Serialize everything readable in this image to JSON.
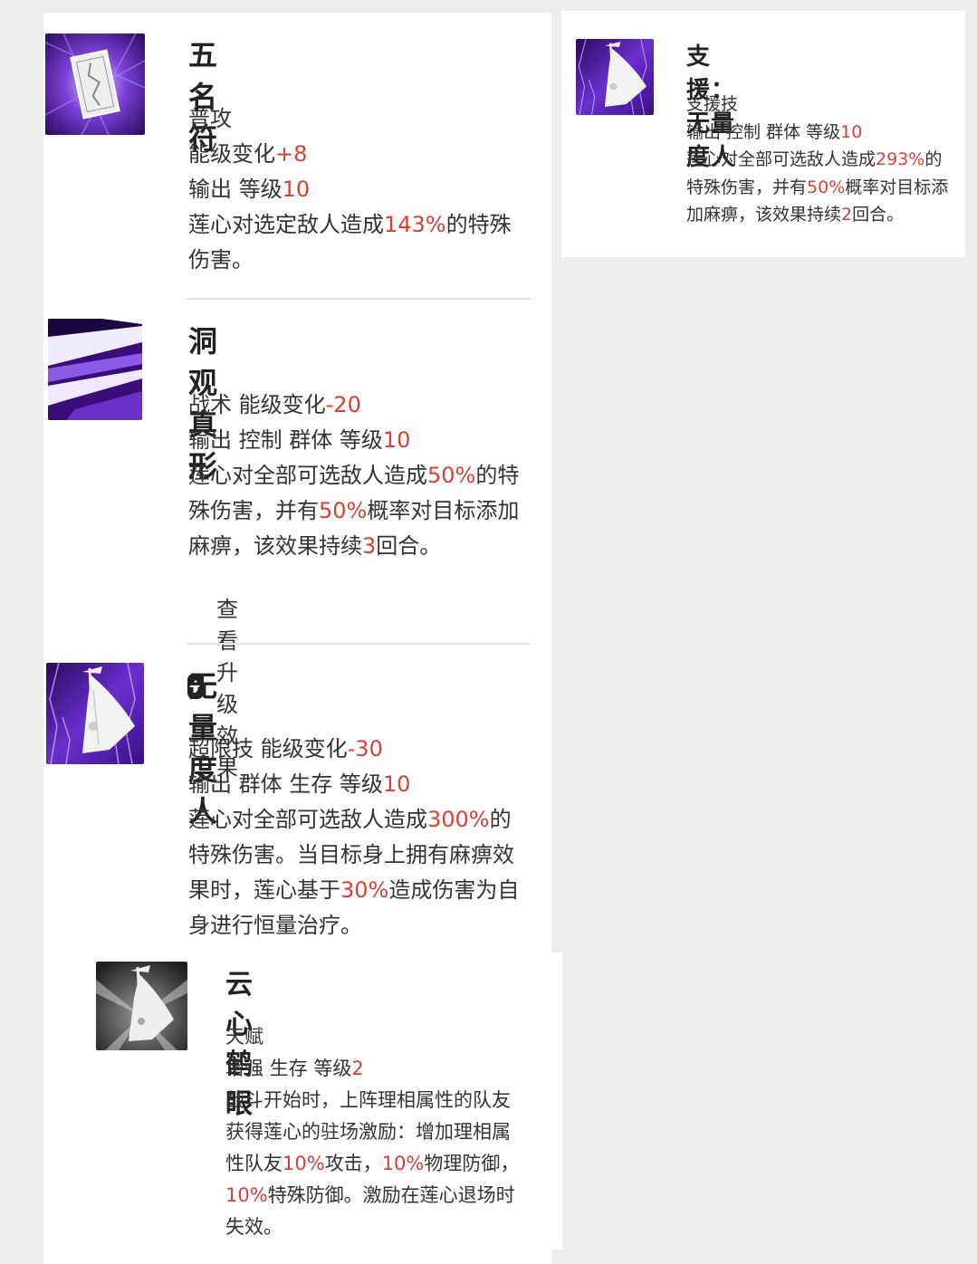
{
  "colors": {
    "highlight": "#d64036",
    "title": "#222222",
    "text": "#333333"
  },
  "skills": [
    {
      "name": "五名符",
      "icon": "talisman-icon",
      "lines": [
        [
          {
            "t": "普攻"
          }
        ],
        [
          {
            "t": "能级变化"
          },
          {
            "t": "+8",
            "hl": true
          }
        ],
        [
          {
            "t": "输出 等级"
          },
          {
            "t": "10",
            "hl": true
          }
        ],
        [
          {
            "t": "莲心对选定敌人造成"
          },
          {
            "t": "143%",
            "hl": true
          },
          {
            "t": "的特殊"
          }
        ],
        [
          {
            "t": "伤害。"
          }
        ]
      ]
    },
    {
      "name": "洞观真形",
      "icon": "slash-streaks-icon",
      "lines": [
        [
          {
            "t": "战术 能级变化"
          },
          {
            "t": "-20",
            "hl": true
          }
        ],
        [
          {
            "t": "输出 控制 群体 等级"
          },
          {
            "t": "10",
            "hl": true
          }
        ],
        [
          {
            "t": "莲心对全部可选敌人造成"
          },
          {
            "t": "50%",
            "hl": true
          },
          {
            "t": "的特"
          }
        ],
        [
          {
            "t": "殊伤害，并有"
          },
          {
            "t": "50%",
            "hl": true
          },
          {
            "t": "概率对目标添加"
          }
        ],
        [
          {
            "t": "麻痹，该效果持续"
          },
          {
            "t": "3",
            "hl": true
          },
          {
            "t": "回合。"
          }
        ]
      ],
      "upgrade_label": "查看升级效果"
    },
    {
      "name": "无量度人",
      "icon": "banner-purple-icon",
      "lines": [
        [
          {
            "t": "超限技 能级变化"
          },
          {
            "t": "-30",
            "hl": true
          }
        ],
        [
          {
            "t": "输出 群体 生存 等级"
          },
          {
            "t": "10",
            "hl": true
          }
        ],
        [
          {
            "t": "莲心对全部可选敌人造成"
          },
          {
            "t": "300%",
            "hl": true
          },
          {
            "t": "的"
          }
        ],
        [
          {
            "t": "特殊伤害。当目标身上拥有麻痹效"
          }
        ],
        [
          {
            "t": "果时，莲心基于"
          },
          {
            "t": "30%",
            "hl": true
          },
          {
            "t": "造成伤害为自"
          }
        ],
        [
          {
            "t": "身进行恒量治疗。"
          }
        ]
      ]
    },
    {
      "name": "支援：无量度人",
      "icon": "banner-purple-icon",
      "lines": [
        [
          {
            "t": "支援技"
          }
        ],
        [
          {
            "t": "输出 控制 群体 等级"
          },
          {
            "t": "10",
            "hl": true
          }
        ],
        [
          {
            "t": "莲心对全部可选敌人造成"
          },
          {
            "t": "293%",
            "hl": true
          },
          {
            "t": "的"
          }
        ],
        [
          {
            "t": "特殊伤害，并有"
          },
          {
            "t": "50%",
            "hl": true
          },
          {
            "t": "概率对目标添"
          }
        ],
        [
          {
            "t": "加麻痹，该效果持续"
          },
          {
            "t": "2",
            "hl": true
          },
          {
            "t": "回合。"
          }
        ]
      ]
    },
    {
      "name": "云心鹤眼",
      "icon": "banner-gray-icon",
      "lines": [
        [
          {
            "t": "天赋"
          }
        ],
        [
          {
            "t": "增强 生存 等级"
          },
          {
            "t": "2",
            "hl": true
          }
        ],
        [
          {
            "t": "战斗开始时，上阵理相属性的队友"
          }
        ],
        [
          {
            "t": "获得莲心的驻场激励：增加理相属"
          }
        ],
        [
          {
            "t": "性队友"
          },
          {
            "t": "10%",
            "hl": true
          },
          {
            "t": "攻击，"
          },
          {
            "t": "10%",
            "hl": true
          },
          {
            "t": "物理防御，"
          }
        ],
        [
          {
            "t": "10%",
            "hl": true
          },
          {
            "t": "特殊防御。激励在莲心退场时"
          }
        ],
        [
          {
            "t": "失效。"
          }
        ]
      ]
    }
  ]
}
